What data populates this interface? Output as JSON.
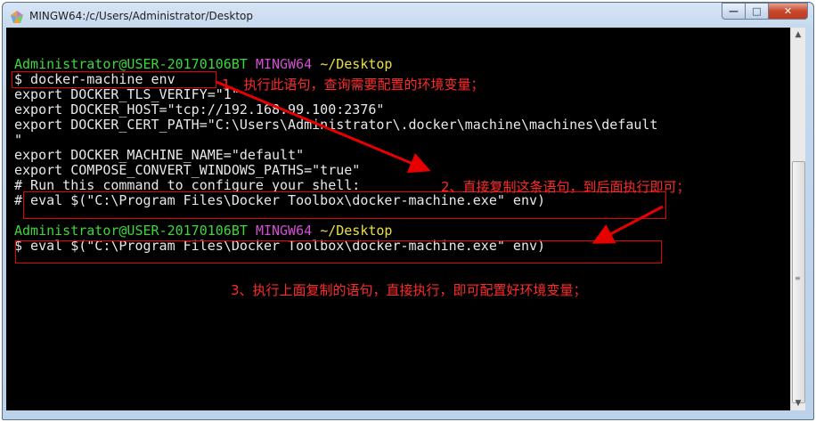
{
  "window": {
    "title": "MINGW64:/c/Users/Administrator/Desktop"
  },
  "titlebar_buttons": {
    "minimize": "—",
    "maximize": "□",
    "close": "✕"
  },
  "terminal": {
    "lines": [
      {
        "user": "Administrator@USER-20170106BT",
        "sys": "MINGW64",
        "path": "~/Desktop"
      },
      "$ docker-machine env",
      "export DOCKER_TLS_VERIFY=\"1\"",
      "export DOCKER_HOST=\"tcp://192.168.99.100:2376\"",
      "export DOCKER_CERT_PATH=\"C:\\Users\\Administrator\\.docker\\machine\\machines\\default",
      "\"",
      "export DOCKER_MACHINE_NAME=\"default\"",
      "export COMPOSE_CONVERT_WINDOWS_PATHS=\"true\"",
      "# Run this command to configure your shell:",
      "# eval $(\"C:\\Program Files\\Docker Toolbox\\docker-machine.exe\" env)",
      "",
      {
        "user": "Administrator@USER-20170106BT",
        "sys": "MINGW64",
        "path": "~/Desktop"
      },
      "$ eval $(\"C:\\Program Files\\Docker Toolbox\\docker-machine.exe\" env)"
    ]
  },
  "annotations": {
    "note1": "1、执行此语句，查询需要配置的环境变量；",
    "note2": "2、直接复制这条语句，到后面执行即可；",
    "note3": "3、执行上面复制的语句，直接执行，即可配置好环境变量；",
    "color": "#ff2a2a"
  },
  "icons": {
    "app": "mingw-app-icon",
    "scroll_up": "▲",
    "scroll_down": "▼",
    "grip": "≡"
  }
}
